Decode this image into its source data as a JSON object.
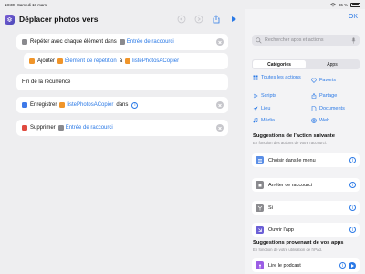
{
  "status_bar": {
    "time": "18:30",
    "date": "Samedi 18 mars",
    "battery": "86 %"
  },
  "header": {
    "title": "Déplacer photos vers"
  },
  "actions": [
    {
      "label": "Répéter avec chaque élément dans",
      "token": "Entrée de raccourci"
    },
    {
      "label": "Ajouter",
      "token1": "Élément de répétition",
      "connector": "à",
      "token2": "listePhotosACopier"
    },
    {
      "label": "Fin de la récurrence"
    },
    {
      "label": "Enregistrer",
      "token": "listePhotosACopier",
      "suffix": "dans"
    },
    {
      "label": "Supprimer",
      "token": "Entrée de raccourci"
    }
  ],
  "panel": {
    "ok": "OK",
    "search_placeholder": "Rechercher apps et actions",
    "tabs": [
      "Catégories",
      "Apps"
    ],
    "categories": [
      {
        "label": "Toutes les actions",
        "icon": "all-actions-icon"
      },
      {
        "label": "Favoris",
        "icon": "heart-icon"
      },
      {
        "label": "Scripts",
        "icon": "scripts-icon"
      },
      {
        "label": "Partage",
        "icon": "share-icon"
      },
      {
        "label": "Lieu",
        "icon": "location-icon"
      },
      {
        "label": "Documents",
        "icon": "document-icon"
      },
      {
        "label": "Média",
        "icon": "music-icon"
      },
      {
        "label": "Web",
        "icon": "globe-icon"
      }
    ],
    "suggestions_title": "Suggestions de l'action suivante",
    "suggestions_sub": "En fonction des actions de votre raccourci.",
    "suggestions": [
      {
        "label": "Choisir dans le menu",
        "color": "#5a8ee6"
      },
      {
        "label": "Arrêter ce raccourci",
        "color": "#8a8a8e"
      },
      {
        "label": "Si",
        "color": "#8a8a8e"
      },
      {
        "label": "Ouvrir l'app",
        "color": "#6b5fd6"
      }
    ],
    "apps_title": "Suggestions provenant de vos apps",
    "apps_sub": "En fonction de votre utilisation de l'iPad.",
    "app_suggestion": {
      "label": "Lire le podcast",
      "color": "#9b5de5"
    }
  },
  "colors": {
    "accent": "#2a79e6",
    "background": "#eeeef0"
  }
}
